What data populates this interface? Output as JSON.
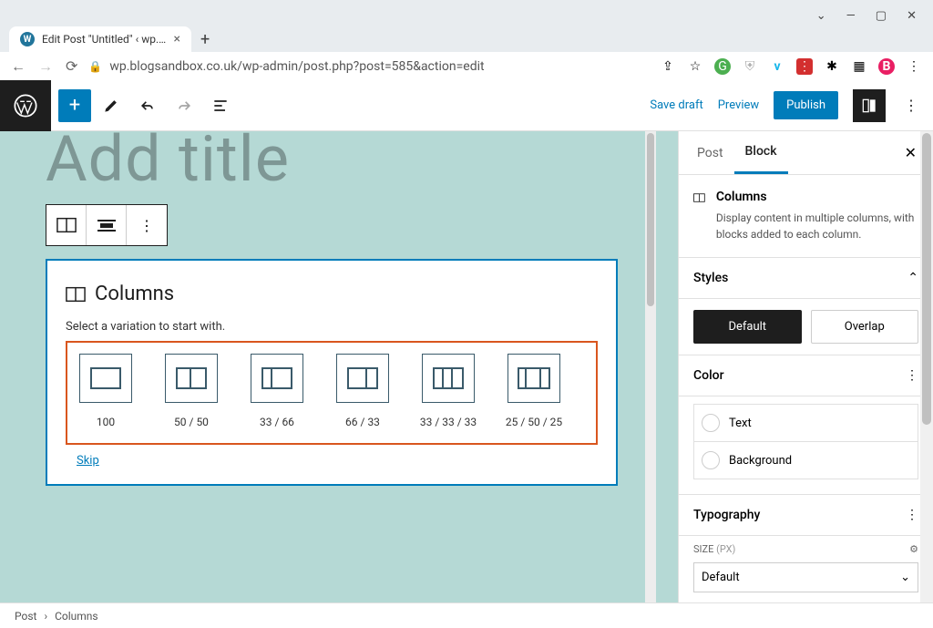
{
  "browser": {
    "tab_title": "Edit Post \"Untitled\" ‹ wp.blogsan…",
    "url": "wp.blogsandbox.co.uk/wp-admin/post.php?post=585&action=edit"
  },
  "topbar": {
    "save_draft": "Save draft",
    "preview": "Preview",
    "publish": "Publish"
  },
  "editor": {
    "title_placeholder": "Add title",
    "columns_heading": "Columns",
    "columns_prompt": "Select a variation to start with.",
    "skip": "Skip",
    "variations": [
      {
        "label": "100",
        "cols": [
          30
        ]
      },
      {
        "label": "50 / 50",
        "cols": [
          15,
          15
        ]
      },
      {
        "label": "33 / 66",
        "cols": [
          10,
          20
        ]
      },
      {
        "label": "66 / 33",
        "cols": [
          20,
          10
        ]
      },
      {
        "label": "33 / 33 / 33",
        "cols": [
          10,
          10,
          10
        ]
      },
      {
        "label": "25 / 50 / 25",
        "cols": [
          8,
          16,
          8
        ]
      }
    ]
  },
  "sidebar": {
    "tab_post": "Post",
    "tab_block": "Block",
    "block_name": "Columns",
    "block_desc": "Display content in multiple columns, with blocks added to each column.",
    "styles_label": "Styles",
    "style_default": "Default",
    "style_overlap": "Overlap",
    "color_label": "Color",
    "color_text": "Text",
    "color_bg": "Background",
    "typo_label": "Typography",
    "size_label": "SIZE",
    "size_unit": "(PX)",
    "size_value": "Default"
  },
  "breadcrumb": {
    "root": "Post",
    "current": "Columns"
  }
}
